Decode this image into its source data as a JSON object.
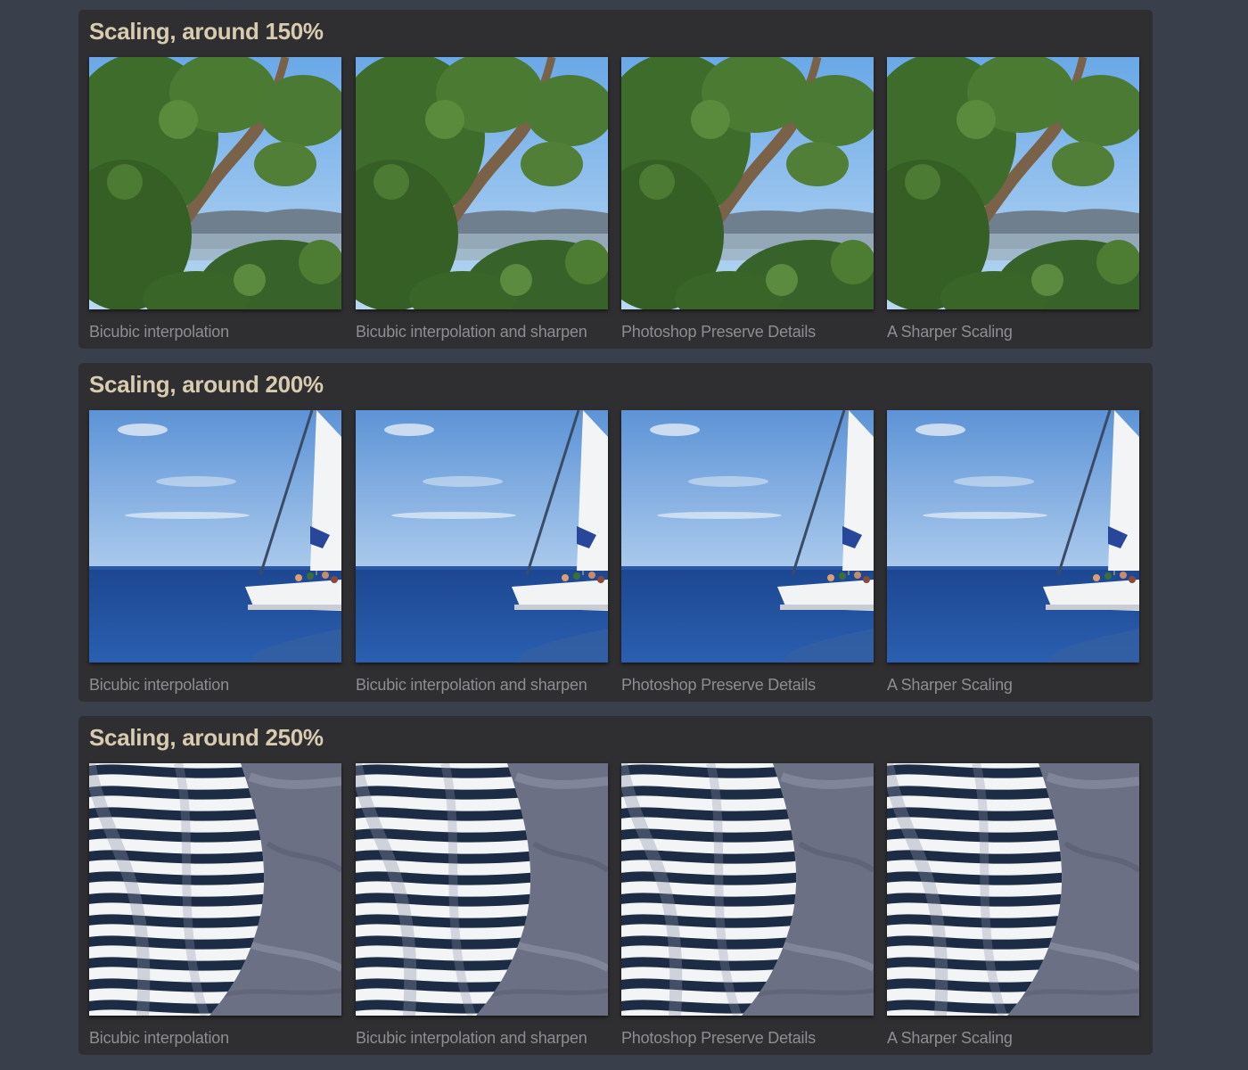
{
  "sections": [
    {
      "title": "Scaling, around 150%",
      "subject": "tree-landscape",
      "captions": [
        "Bicubic interpolation",
        "Bicubic interpolation and sharpen",
        "Photoshop Preserve Details",
        "A Sharper Scaling"
      ]
    },
    {
      "title": "Scaling, around 200%",
      "subject": "sailboat-sea",
      "captions": [
        "Bicubic interpolation",
        "Bicubic interpolation and sharpen",
        "Photoshop Preserve Details",
        "A Sharper Scaling"
      ]
    },
    {
      "title": "Scaling, around 250%",
      "subject": "striped-fabric",
      "captions": [
        "Bicubic interpolation",
        "Bicubic interpolation and sharpen",
        "Photoshop Preserve Details",
        "A Sharper Scaling"
      ]
    }
  ],
  "colors": {
    "page_background": "#3a3f4c",
    "panel_background": "#2f2f31",
    "title_text": "#d8ccb0",
    "caption_text": "#8e8e92"
  }
}
